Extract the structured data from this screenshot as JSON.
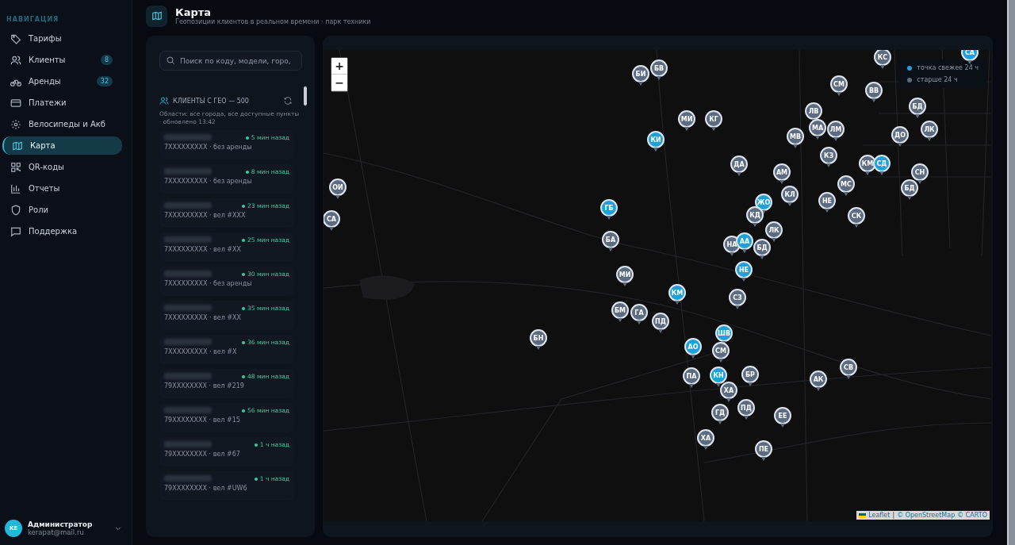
{
  "sidebar": {
    "section_title": "НАВИГАЦИЯ",
    "items": [
      {
        "label": "Тарифы",
        "selected": false
      },
      {
        "label": "Клиенты",
        "badge": "8",
        "selected": false
      },
      {
        "label": "Аренды",
        "badge": "32",
        "selected": false
      },
      {
        "label": "Платежи",
        "selected": false
      },
      {
        "label": "Велосипеды и Акб",
        "selected": false
      },
      {
        "label": "Карта",
        "selected": true
      },
      {
        "label": "QR-коды",
        "selected": false
      },
      {
        "label": "Отчеты",
        "selected": false
      },
      {
        "label": "Роли",
        "selected": false
      },
      {
        "label": "Поддержка",
        "selected": false
      }
    ],
    "user": {
      "initials": "KE",
      "name": "Администратор",
      "email": "kerapat@mail.ru"
    }
  },
  "header": {
    "title": "Карта",
    "subtitle": "Геопозиции клиентов в реальном времени · парк техники"
  },
  "client_panel": {
    "search": {
      "placeholder": "Поиск по коду, модели, горо,"
    },
    "title": "КЛИЕНТЫ С ГЕО — 500",
    "note": "Области: все города, все доступные пункты · обновлено 13:42",
    "clients": [
      {
        "time": "5 мин назад",
        "detail": "7XXXXXXXXX · без аренды"
      },
      {
        "time": "8 мин назад",
        "detail": "7XXXXXXXXX · без аренды"
      },
      {
        "time": "23 мин назад",
        "detail": "7XXXXXXXXX · вел #XXX"
      },
      {
        "time": "25 мин назад",
        "detail": "7XXXXXXXXX · вел #XX"
      },
      {
        "time": "30 мин назад",
        "detail": "7XXXXXXXXX · без аренды"
      },
      {
        "time": "35 мин назад",
        "detail": "7XXXXXXXXX · вел #XX"
      },
      {
        "time": "36 мин назад",
        "detail": "7XXXXXXXXX · вел #X"
      },
      {
        "time": "48 мин назад",
        "detail": "79XXXXXXXX · вел #219"
      },
      {
        "time": "56 мин назад",
        "detail": "79XXXXXXXX · вел #15"
      },
      {
        "time": "1 ч назад",
        "detail": "79XXXXXXXX · вел #67"
      },
      {
        "time": "1 ч назад",
        "detail": "79XXXXXXXX · вел #UW6"
      }
    ]
  },
  "map": {
    "zoom_in": "+",
    "zoom_out": "−",
    "legend": [
      {
        "label": "точка свежее 24 ч",
        "color": "#1ea0d8"
      },
      {
        "label": "старше 24 ч",
        "color": "#5d6b82"
      }
    ],
    "attribution": {
      "leaflet": "Leaflet",
      "separator": "|",
      "osm": "© OpenStreetMap",
      "carto": "© CARTO"
    },
    "markers": [
      {
        "code": "ОИ",
        "fresh": false
      },
      {
        "code": "СА",
        "fresh": false
      },
      {
        "code": "БН",
        "fresh": false
      },
      {
        "code": "БИ",
        "fresh": false
      },
      {
        "code": "БВ",
        "fresh": false
      },
      {
        "code": "МИ",
        "fresh": false
      },
      {
        "code": "КГ",
        "fresh": false
      },
      {
        "code": "КИ",
        "fresh": true
      },
      {
        "code": "МВ",
        "fresh": false
      },
      {
        "code": "ЛВ",
        "fresh": false
      },
      {
        "code": "МА",
        "fresh": false
      },
      {
        "code": "ЛМ",
        "fresh": false
      },
      {
        "code": "КЗ",
        "fresh": false
      },
      {
        "code": "ДА",
        "fresh": false
      },
      {
        "code": "АМ",
        "fresh": false
      },
      {
        "code": "МС",
        "fresh": false
      },
      {
        "code": "НЕ",
        "fresh": false
      },
      {
        "code": "СК",
        "fresh": false
      },
      {
        "code": "КЛ",
        "fresh": false
      },
      {
        "code": "ЖО",
        "fresh": true
      },
      {
        "code": "КД",
        "fresh": false
      },
      {
        "code": "ГБ",
        "fresh": true
      },
      {
        "code": "БА",
        "fresh": false
      },
      {
        "code": "ЛК",
        "fresh": false
      },
      {
        "code": "НА",
        "fresh": false
      },
      {
        "code": "АА",
        "fresh": true
      },
      {
        "code": "БД",
        "fresh": false
      },
      {
        "code": "НЕ",
        "fresh": true
      },
      {
        "code": "МИ",
        "fresh": false
      },
      {
        "code": "КМ",
        "fresh": true
      },
      {
        "code": "СЗ",
        "fresh": false
      },
      {
        "code": "БМ",
        "fresh": false
      },
      {
        "code": "ГА",
        "fresh": false
      },
      {
        "code": "ПД",
        "fresh": false
      },
      {
        "code": "ШВ",
        "fresh": true
      },
      {
        "code": "АО",
        "fresh": true
      },
      {
        "code": "СМ",
        "fresh": false
      },
      {
        "code": "ПА",
        "fresh": false
      },
      {
        "code": "КН",
        "fresh": true
      },
      {
        "code": "БР",
        "fresh": false
      },
      {
        "code": "ХА",
        "fresh": false
      },
      {
        "code": "АК",
        "fresh": false
      },
      {
        "code": "СВ",
        "fresh": false
      },
      {
        "code": "ГД",
        "fresh": false
      },
      {
        "code": "ПД",
        "fresh": false
      },
      {
        "code": "ЕЕ",
        "fresh": false
      },
      {
        "code": "ХА",
        "fresh": false
      },
      {
        "code": "ПЕ",
        "fresh": false
      },
      {
        "code": "КС",
        "fresh": false
      },
      {
        "code": "ВВ",
        "fresh": false
      },
      {
        "code": "СМ",
        "fresh": false
      },
      {
        "code": "СА",
        "fresh": true
      },
      {
        "code": "БД",
        "fresh": false
      },
      {
        "code": "ДО",
        "fresh": false
      },
      {
        "code": "ЛК",
        "fresh": false
      },
      {
        "code": "СН",
        "fresh": false
      },
      {
        "code": "БД",
        "fresh": false
      },
      {
        "code": "КМ",
        "fresh": false
      },
      {
        "code": "СД",
        "fresh": true
      }
    ]
  }
}
